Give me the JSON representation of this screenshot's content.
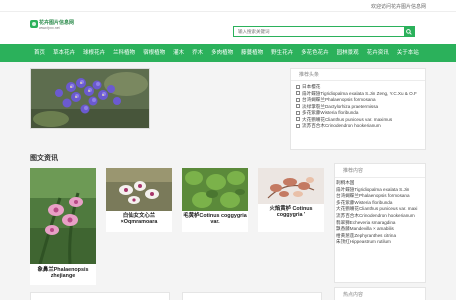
{
  "topbar": {
    "welcome": "欢迎访问花卉图片信息网"
  },
  "logo": {
    "title": "花卉图片信息网",
    "url": "www.fpxx.net"
  },
  "search": {
    "placeholder": "输入搜索关键词"
  },
  "nav": {
    "items": [
      "首页",
      "草本花卉",
      "球根花卉",
      "兰科植物",
      "宿根植物",
      "灌木",
      "乔木",
      "多肉植物",
      "藤蔓植物",
      "野生花卉",
      "多花色花卉",
      "园林景观",
      "花卉资讯",
      "关于本站"
    ]
  },
  "recommend": {
    "title": "推荐头条",
    "items": [
      "日本樱花",
      "扇叶蝶翅Tigridiopalma exalata S.Jin Zeng, Y.C.Xu & O.F",
      "台湾蝴蝶兰Phalaenopsis formosana",
      "淡绿掌裂兰Dactylorhiza praetermissa",
      "多花紫藤Wisteria floribunda",
      "大花鹦嘴花Clianthus puniceus var. maximus",
      "流苏百合木Crinodendron hookerianum"
    ]
  },
  "news": {
    "title": "图文资讯",
    "cards": [
      {
        "caption": "象鼻兰Phalaenopsis zhejiange"
      },
      {
        "caption": "白仙女文心兰 ×Oqmramoara"
      },
      {
        "caption": "毛黄栌Cotinus coggygria var."
      },
      {
        "caption": "火焰黄栌 Cotinus coggygria '"
      }
    ]
  },
  "related": {
    "title": "推荐内容",
    "items": [
      "刺桐木国",
      "扇叶蝶翅Tigridiopalma exalata S.Jin",
      "台湾蝴蝶兰Phalaenopsis formosana",
      "多花紫藤Wisteria floribunda",
      "大花鹦嘴花Clianthus puniceus var. maxi",
      "流苏百合木Crinodendron hookerianum",
      "翡翠狮Echeveria smaragdina",
      "飘香藤Mandevilla × amabilis",
      "柑黄葱莲Zephyranthes citrina",
      "朱顶红Hippeastrum rutilum"
    ]
  },
  "hot": {
    "title": "热点内容"
  },
  "colors": {
    "brand": "#2bb15b",
    "text": "#444444",
    "background": "#f4f4f4"
  }
}
